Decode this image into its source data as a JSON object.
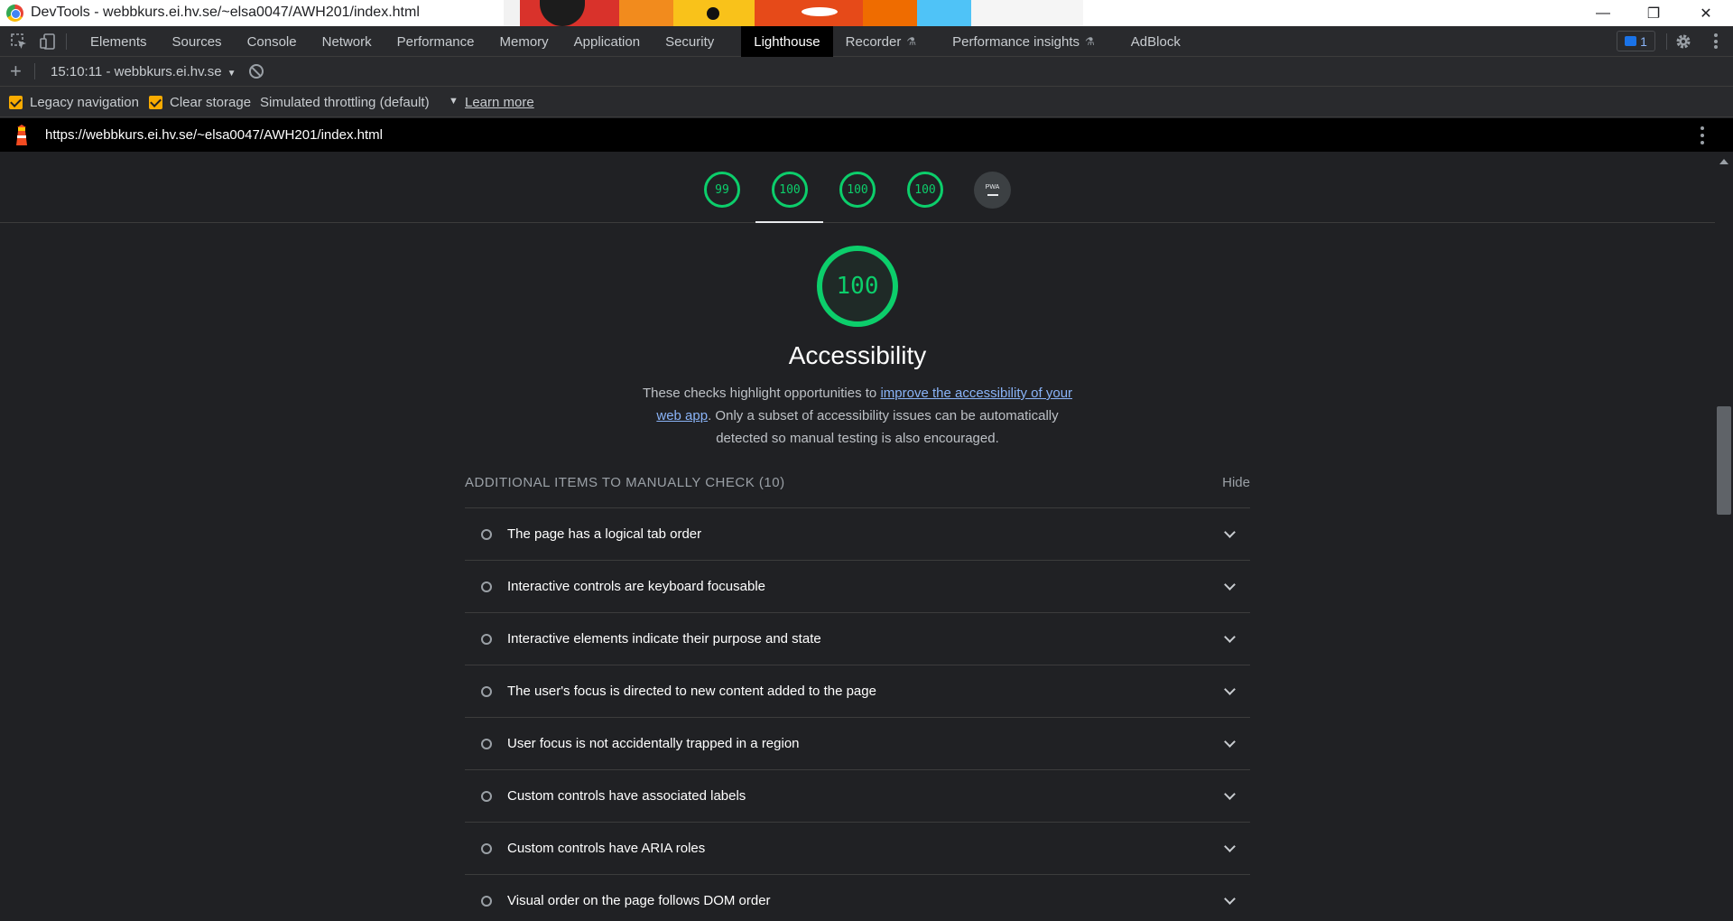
{
  "window": {
    "title": "DevTools - webbkurs.ei.hv.se/~elsa0047/AWH201/index.html",
    "minimize": "—",
    "restore": "❐",
    "close": "✕"
  },
  "toolbar": {
    "tabs": [
      {
        "label": "Elements"
      },
      {
        "label": "Sources"
      },
      {
        "label": "Console"
      },
      {
        "label": "Network"
      },
      {
        "label": "Performance"
      },
      {
        "label": "Memory"
      },
      {
        "label": "Application"
      },
      {
        "label": "Security"
      },
      {
        "label": "Lighthouse"
      },
      {
        "label": "Recorder"
      },
      {
        "label": "Performance insights"
      },
      {
        "label": "AdBlock"
      }
    ],
    "active_tab": "Lighthouse",
    "issues_count": "1",
    "flask_icon": "⚗"
  },
  "report_bar": {
    "add": "+",
    "selected_report": "15:10:11 - webbkurs.ei.hv.se",
    "caret": "▼"
  },
  "settings_bar": {
    "legacy_navigation": "Legacy navigation",
    "clear_storage": "Clear storage",
    "throttling": "Simulated throttling (default)",
    "throttle_caret": "▼",
    "learn_more": "Learn more"
  },
  "url_bar": {
    "url": "https://webbkurs.ei.hv.se/~elsa0047/AWH201/index.html"
  },
  "gauges": {
    "scores": [
      "99",
      "100",
      "100",
      "100"
    ],
    "pwa_label": "PWA"
  },
  "category": {
    "score": "100",
    "title": "Accessibility",
    "desc_pre": "These checks highlight opportunities to ",
    "desc_link": "improve the accessibility of your web app",
    "desc_post": ". Only a subset of accessibility issues can be automatically detected so manual testing is also encouraged."
  },
  "manual": {
    "title": "ADDITIONAL ITEMS TO MANUALLY CHECK (10)",
    "hide": "Hide",
    "items": [
      "The page has a logical tab order",
      "Interactive controls are keyboard focusable",
      "Interactive elements indicate their purpose and state",
      "The user's focus is directed to new content added to the page",
      "User focus is not accidentally trapped in a region",
      "Custom controls have associated labels",
      "Custom controls have ARIA roles",
      "Visual order on the page follows DOM order"
    ]
  },
  "colors": {
    "pass_green": "#0cce6b",
    "link_blue": "#8ab4f8",
    "checkbox_orange": "#f9ab00",
    "panel_bg": "#202124"
  }
}
